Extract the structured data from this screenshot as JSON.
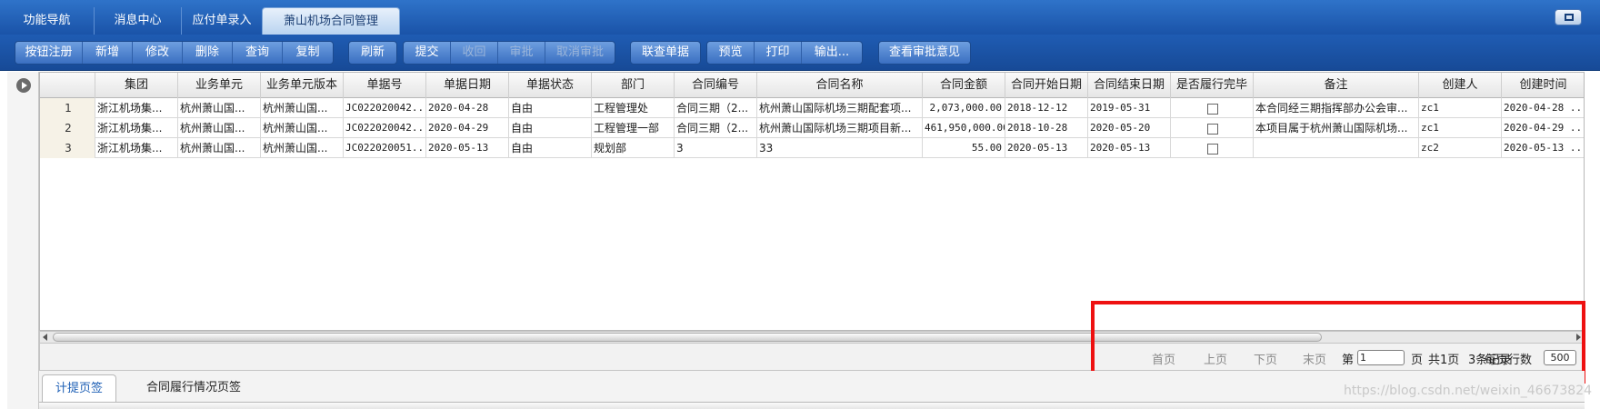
{
  "header": {
    "tabs": [
      {
        "label": "功能导航"
      },
      {
        "label": "消息中心"
      },
      {
        "label": "应付单录入"
      },
      {
        "label": "萧山机场合同管理"
      }
    ]
  },
  "toolbar": {
    "groups": [
      [
        "按钮注册",
        "新增",
        "修改",
        "删除",
        "查询",
        "复制"
      ],
      [
        "刷新"
      ],
      [
        "提交",
        "收回",
        "审批",
        "取消审批"
      ],
      [
        "联查单据"
      ],
      [
        "预览",
        "打印",
        "输出..."
      ],
      [
        "查看审批意见"
      ]
    ],
    "disabled": [
      "收回",
      "审批",
      "取消审批"
    ]
  },
  "grid": {
    "columns": [
      "集团",
      "业务单元",
      "业务单元版本",
      "单据号",
      "单据日期",
      "单据状态",
      "部门",
      "合同编号",
      "合同名称",
      "合同金额",
      "合同开始日期",
      "合同结束日期",
      "是否履行完毕",
      "备注",
      "创建人",
      "创建时间"
    ],
    "rows": [
      {
        "n": "1",
        "cells": [
          "浙江机场集...",
          "杭州萧山国...",
          "杭州萧山国...",
          "JC022020042...",
          "2020-04-28",
          "自由",
          "工程管理处",
          "合同三期（2...",
          "杭州萧山国际机场三期配套项...",
          "2,073,000.00",
          "2018-12-12",
          "2019-05-31",
          "",
          "本合同经三期指挥部办公会审...",
          "zc1",
          "2020-04-28 ..."
        ]
      },
      {
        "n": "2",
        "cells": [
          "浙江机场集...",
          "杭州萧山国...",
          "杭州萧山国...",
          "JC022020042...",
          "2020-04-29",
          "自由",
          "工程管理一部",
          "合同三期（2...",
          "杭州萧山国际机场三期项目新...",
          "461,950,000.00",
          "2018-10-28",
          "2020-05-20",
          "",
          "本项目属于杭州萧山国际机场...",
          "zc1",
          "2020-04-29 ..."
        ]
      },
      {
        "n": "3",
        "cells": [
          "浙江机场集...",
          "杭州萧山国...",
          "杭州萧山国...",
          "JC022020051...",
          "2020-05-13",
          "自由",
          "规划部",
          "3",
          "33",
          "55.00",
          "2020-05-13",
          "2020-05-13",
          "",
          "",
          "zc2",
          "2020-05-13 ..."
        ]
      }
    ]
  },
  "pager": {
    "first": "首页",
    "prev": "上页",
    "next": "下页",
    "last": "末页",
    "page_prefix": "第",
    "page_value": "1",
    "page_suffix": "页",
    "total_pages": "共1页",
    "record_count": "3条记录",
    "rows_label": "每页行数",
    "rows_value": "500"
  },
  "bottom_tabs": [
    "计提页签",
    "合同履行情况页签"
  ],
  "watermark": "https://blog.csdn.net/weixin_46673824",
  "colors": {
    "header_blue": "#1a53a8",
    "highlight_red": "#ee1111"
  }
}
